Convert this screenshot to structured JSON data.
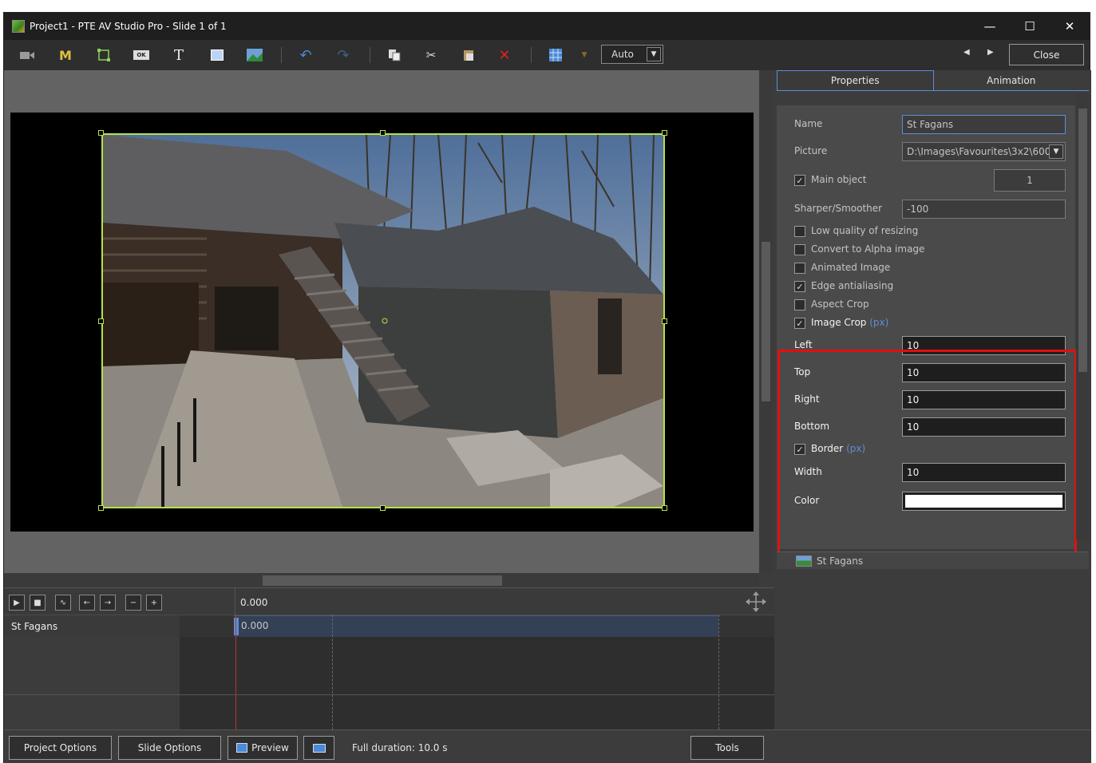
{
  "window": {
    "title": "Project1 - PTE AV Studio Pro - Slide 1 of 1"
  },
  "toolbar": {
    "zoom_value": "Auto",
    "close_label": "Close",
    "text_tool_glyph": "T",
    "m_tool_glyph": "M",
    "ok_glyph": "OK"
  },
  "timeline": {
    "ruler_time": "0.000",
    "track_name": "St Fagans",
    "clip_time": "0.000"
  },
  "bottombar": {
    "project_options": "Project Options",
    "slide_options": "Slide Options",
    "preview": "Preview",
    "duration": "Full duration: 10.0 s",
    "tools": "Tools"
  },
  "panel": {
    "tab_properties": "Properties",
    "tab_animation": "Animation",
    "name_label": "Name",
    "name_value": "St Fagans",
    "picture_label": "Picture",
    "picture_value": "D:\\Images\\Favourites\\3x2\\600",
    "main_object_label": "Main object",
    "main_object_value": "1",
    "sharper_label": "Sharper/Smoother",
    "sharper_value": "-100",
    "low_quality_label": "Low quality of resizing",
    "alpha_label": "Convert to Alpha image",
    "animated_label": "Animated Image",
    "edge_label": "Edge antialiasing",
    "aspect_label": "Aspect Crop",
    "image_crop_label": "Image Crop",
    "px_unit": "(px)",
    "left_label": "Left",
    "left_value": "10",
    "top_label": "Top",
    "top_value": "10",
    "right_label": "Right",
    "right_value": "10",
    "bottom_label": "Bottom",
    "bottom_value": "10",
    "border_label": "Border",
    "width_label": "Width",
    "width_value": "10",
    "color_label": "Color",
    "color_value": "#ffffff",
    "main_object_checked": true,
    "low_quality_checked": false,
    "alpha_checked": false,
    "animated_checked": false,
    "edge_checked": true,
    "aspect_checked": false,
    "image_crop_checked": true,
    "border_checked": true
  },
  "object_list": {
    "items": [
      "St Fagans"
    ]
  },
  "colors": {
    "highlight_box": "#e01010",
    "selection_frame": "#b8e04a",
    "accent": "#5b8fd6",
    "playhead": "#c03030"
  }
}
